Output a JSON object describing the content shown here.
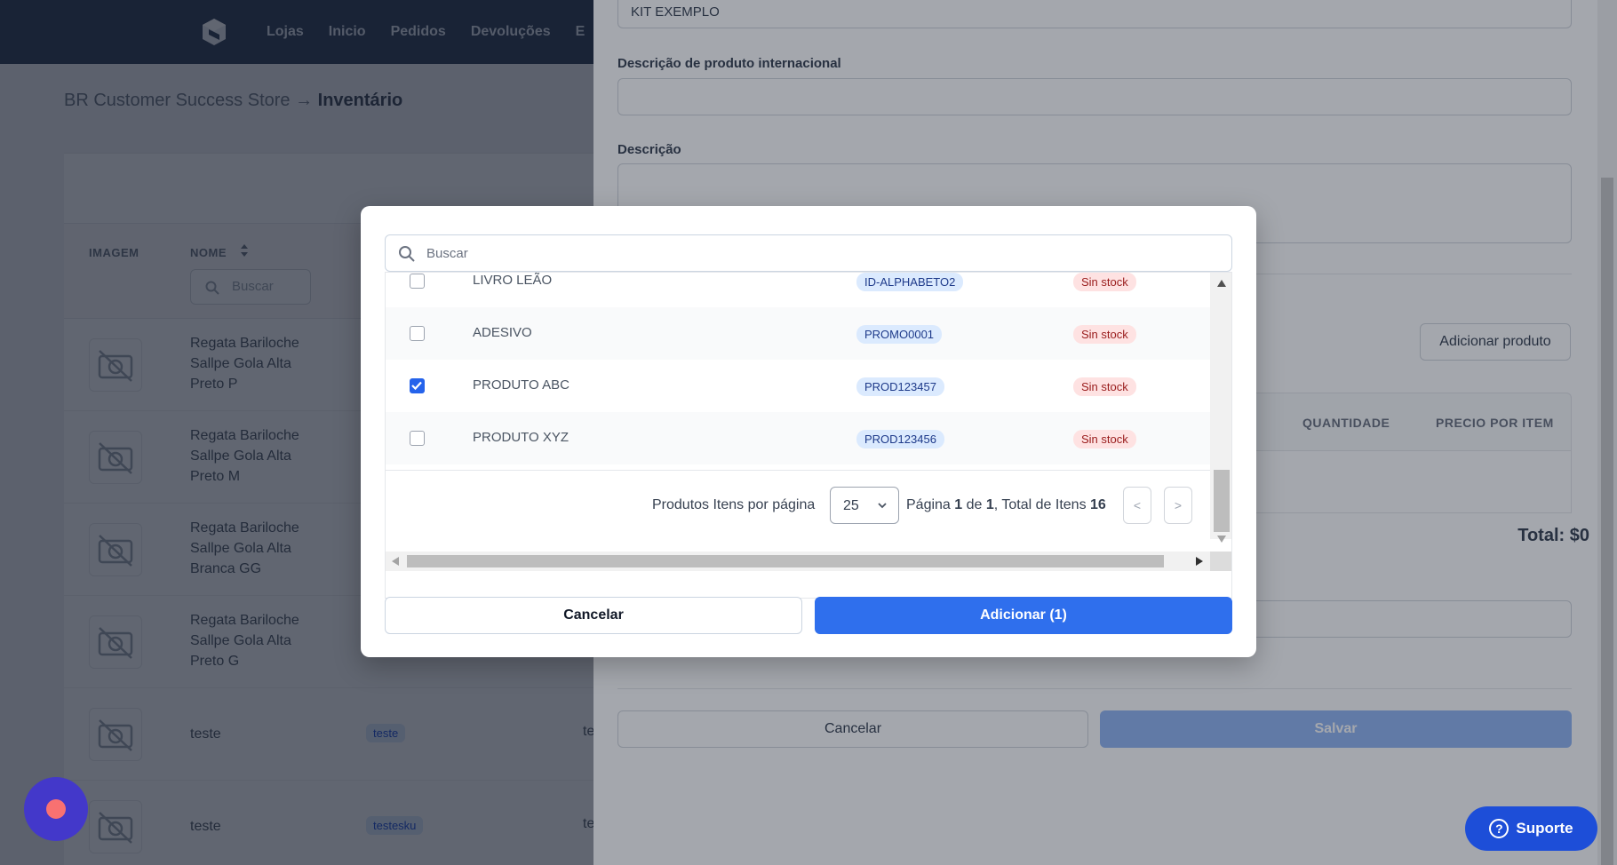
{
  "nav": {
    "links": [
      "Lojas",
      "Inicio",
      "Pedidos",
      "Devoluções",
      "E"
    ]
  },
  "breadcrumb": {
    "store": "BR Customer Success Store",
    "arrow": "→",
    "page": "Inventário"
  },
  "inventory": {
    "columns": {
      "image": "IMAGEM",
      "name": "NOME"
    },
    "search_placeholder": "Buscar",
    "rows": [
      {
        "name_lines": [
          "Regata Bariloche",
          "Sallpe Gola Alta",
          "Preto P"
        ]
      },
      {
        "name_lines": [
          "Regata Bariloche",
          "Sallpe Gola Alta",
          "Preto M"
        ]
      },
      {
        "name_lines": [
          "Regata Bariloche",
          "Sallpe Gola Alta",
          "Branca GG"
        ]
      },
      {
        "name_lines": [
          "Regata Bariloche",
          "Sallpe Gola Alta",
          "Preto G"
        ]
      },
      {
        "name_lines": [
          "teste"
        ],
        "sku": "teste",
        "extra": "te"
      },
      {
        "name_lines": [
          "teste"
        ],
        "sku": "testesku",
        "extra": "te"
      }
    ]
  },
  "drawer": {
    "kit_name_value": "KIT EXEMPLO",
    "intl_desc_label": "Descrição de produto internacional",
    "desc_label": "Descrição",
    "add_product_label": "Adicionar produto",
    "columns": {
      "quantity": "QUANTIDADE",
      "price": "PRECIO POR ITEM"
    },
    "total": "Total: $0",
    "cancel_label": "Cancelar",
    "save_label": "Salvar"
  },
  "modal": {
    "search_placeholder": "Buscar",
    "products": [
      {
        "name": "LIVRO LEÃO",
        "code": "ID-ALPHABETO2",
        "stock": "Sin stock",
        "checked": false
      },
      {
        "name": "ADESIVO",
        "code": "PROMO0001",
        "stock": "Sin stock",
        "checked": false
      },
      {
        "name": "PRODUTO ABC",
        "code": "PROD123457",
        "stock": "Sin stock",
        "checked": true
      },
      {
        "name": "PRODUTO XYZ",
        "code": "PROD123456",
        "stock": "Sin stock",
        "checked": false
      }
    ],
    "pager": {
      "per_page_label": "Produtos Itens por página",
      "per_page_value": "25",
      "page_label": "Página",
      "page": "1",
      "of_label": "de",
      "pages": "1",
      "total_label": ", Total de Itens",
      "total": "16",
      "prev": "<",
      "next": ">"
    },
    "cancel_label": "Cancelar",
    "add_label": "Adicionar (1)"
  },
  "support_label": "Suporte",
  "colors": {
    "primary": "#2f6fed",
    "nav": "#2b3a55",
    "stock_bg": "#fee2e2",
    "code_bg": "#dbeafe"
  }
}
